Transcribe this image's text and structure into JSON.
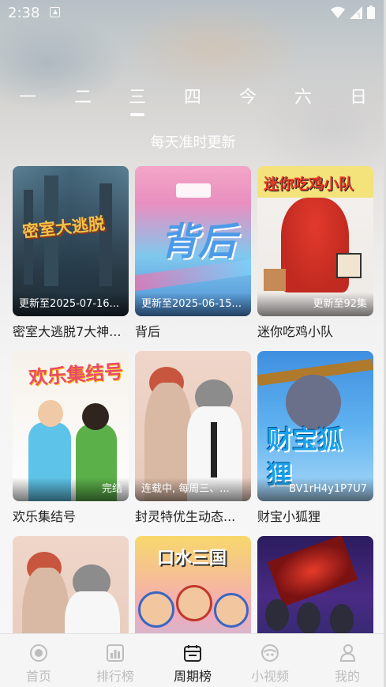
{
  "status": {
    "time": "2:38"
  },
  "day_tabs": [
    {
      "label": "一"
    },
    {
      "label": "二"
    },
    {
      "label": "三"
    },
    {
      "label": "四"
    },
    {
      "label": "今"
    },
    {
      "label": "六"
    },
    {
      "label": "日"
    }
  ],
  "active_day_index": 2,
  "subtitle": "每天准时更新",
  "shows": [
    {
      "title": "密室大逃脱7大神...",
      "badge": "更新至2025-07-16...",
      "poster_text": "密室大逃脱"
    },
    {
      "title": "背后",
      "badge": "更新至2025-06-15...",
      "poster_text": "背后"
    },
    {
      "title": "迷你吃鸡小队",
      "badge": "更新至92集",
      "poster_text": "迷你吃鸡小队"
    },
    {
      "title": "欢乐集结号",
      "badge": "完结",
      "poster_text": "欢乐集结号"
    },
    {
      "title": "封灵特优生动态...",
      "badge": "连载中, 每周三、...",
      "poster_text": ""
    },
    {
      "title": "财宝小狐狸",
      "badge": "BV1rH4y1P7U7",
      "poster_text": "财宝狐狸"
    },
    {
      "title": "",
      "badge": "",
      "poster_text": ""
    },
    {
      "title": "",
      "badge": "",
      "poster_text": "口水三国"
    },
    {
      "title": "",
      "badge": "",
      "poster_text": ""
    }
  ],
  "bottom_nav": [
    {
      "label": "首页",
      "icon": "home-icon"
    },
    {
      "label": "排行榜",
      "icon": "ranking-icon"
    },
    {
      "label": "周期榜",
      "icon": "calendar-icon"
    },
    {
      "label": "小视频",
      "icon": "short-video-icon"
    },
    {
      "label": "我的",
      "icon": "profile-icon"
    }
  ],
  "active_nav_index": 2
}
